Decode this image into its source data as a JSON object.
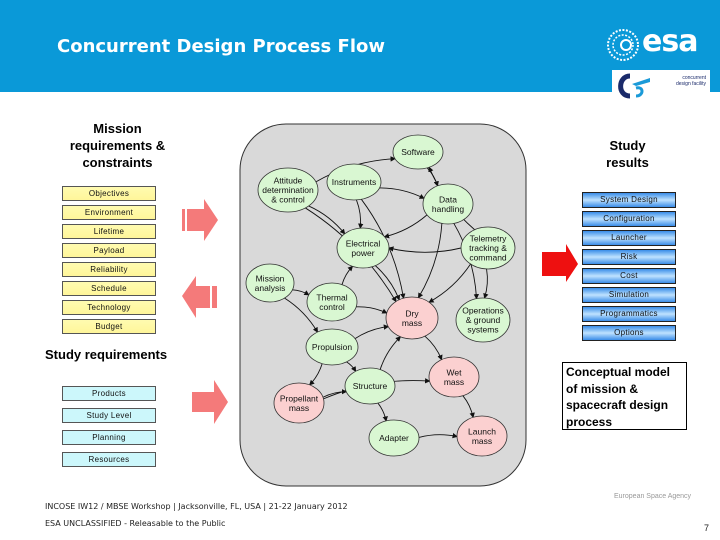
{
  "header": {
    "title": "Concurrent Design Process Flow",
    "esa_logo": "esa",
    "cdf_logo_lines": [
      "concurrent",
      "design facility"
    ],
    "background_color": "#0a99d8"
  },
  "mission_requirements": {
    "heading": "Mission requirements & constraints",
    "items": [
      "Objectives",
      "Environment",
      "Lifetime",
      "Payload",
      "Reliability",
      "Schedule",
      "Technology",
      "Budget"
    ]
  },
  "study_requirements": {
    "heading": "Study requirements",
    "items": [
      "Products",
      "Study Level",
      "Planning",
      "Resources"
    ]
  },
  "study_results": {
    "heading": "Study results",
    "items": [
      "System Design",
      "Configuration",
      "Launcher",
      "Risk",
      "Cost",
      "Simulation",
      "Programmatics",
      "Options"
    ]
  },
  "diagram": {
    "nodes": [
      {
        "id": "software",
        "label": [
          "Software"
        ],
        "type": "subsystem"
      },
      {
        "id": "attitude",
        "label": [
          "Attitude",
          "determination",
          "& control"
        ],
        "type": "subsystem"
      },
      {
        "id": "instruments",
        "label": [
          "Instruments"
        ],
        "type": "subsystem"
      },
      {
        "id": "data",
        "label": [
          "Data",
          "handling"
        ],
        "type": "subsystem"
      },
      {
        "id": "power",
        "label": [
          "Electrical",
          "power"
        ],
        "type": "subsystem"
      },
      {
        "id": "telemetry",
        "label": [
          "Telemetry",
          "tracking &",
          "command"
        ],
        "type": "subsystem"
      },
      {
        "id": "mission",
        "label": [
          "Mission",
          "analysis"
        ],
        "type": "subsystem"
      },
      {
        "id": "thermal",
        "label": [
          "Thermal",
          "control"
        ],
        "type": "subsystem"
      },
      {
        "id": "drymass",
        "label": [
          "Dry",
          "mass"
        ],
        "type": "mass"
      },
      {
        "id": "operations",
        "label": [
          "Operations",
          "& ground",
          "systems"
        ],
        "type": "subsystem"
      },
      {
        "id": "propulsion",
        "label": [
          "Propulsion"
        ],
        "type": "subsystem"
      },
      {
        "id": "wetmass",
        "label": [
          "Wet",
          "mass"
        ],
        "type": "mass"
      },
      {
        "id": "structure",
        "label": [
          "Structure"
        ],
        "type": "subsystem"
      },
      {
        "id": "propellant",
        "label": [
          "Propellant",
          "mass"
        ],
        "type": "mass"
      },
      {
        "id": "adapter",
        "label": [
          "Adapter"
        ],
        "type": "subsystem"
      },
      {
        "id": "launchmass",
        "label": [
          "Launch",
          "mass"
        ],
        "type": "mass"
      }
    ],
    "edges": [
      [
        "attitude",
        "software"
      ],
      [
        "software",
        "data"
      ],
      [
        "telemetry",
        "software"
      ],
      [
        "instruments",
        "data"
      ],
      [
        "instruments",
        "power"
      ],
      [
        "instruments",
        "drymass"
      ],
      [
        "attitude",
        "power"
      ],
      [
        "attitude",
        "drymass"
      ],
      [
        "data",
        "power"
      ],
      [
        "data",
        "drymass"
      ],
      [
        "data",
        "operations"
      ],
      [
        "telemetry",
        "power"
      ],
      [
        "telemetry",
        "drymass"
      ],
      [
        "telemetry",
        "operations"
      ],
      [
        "power",
        "drymass"
      ],
      [
        "mission",
        "thermal"
      ],
      [
        "mission",
        "propulsion"
      ],
      [
        "thermal",
        "power"
      ],
      [
        "thermal",
        "drymass"
      ],
      [
        "propulsion",
        "drymass"
      ],
      [
        "propulsion",
        "structure"
      ],
      [
        "propulsion",
        "propellant"
      ],
      [
        "structure",
        "drymass"
      ],
      [
        "propellant",
        "structure"
      ],
      [
        "propellant",
        "wetmass"
      ],
      [
        "drymass",
        "wetmass"
      ],
      [
        "structure",
        "adapter"
      ],
      [
        "adapter",
        "launchmass"
      ],
      [
        "wetmass",
        "launchmass"
      ]
    ],
    "colors": {
      "subsystem": "#d9f7d2",
      "mass": "#fbd0d0",
      "panel": "#d9d9d9"
    }
  },
  "concept_label": "Conceptual model of mission & spacecraft design process",
  "footer": {
    "event": "INCOSE IW12 / MBSE Workshop | Jacksonville, FL, USA | 21-22 January 2012",
    "classification": "ESA UNCLASSIFIED - Releasable to the Public",
    "agency": "European Space Agency",
    "page_number": "7"
  }
}
